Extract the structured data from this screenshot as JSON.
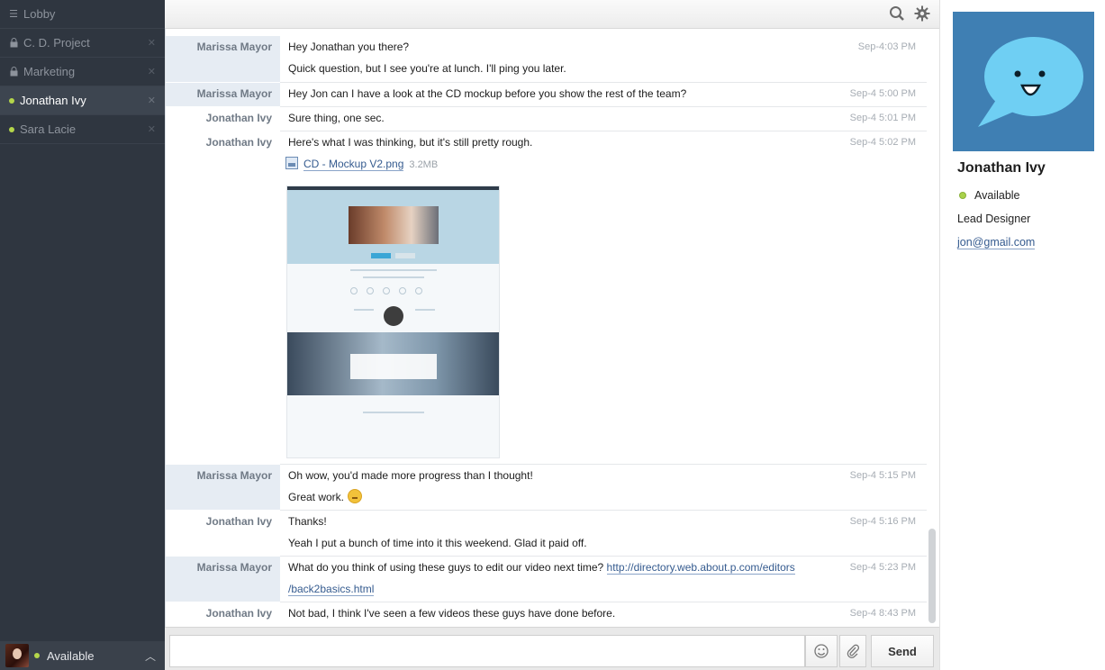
{
  "sidebar": {
    "items": [
      {
        "label": "Lobby",
        "icon": "list-icon"
      },
      {
        "label": "C. D. Project",
        "icon": "lock-icon"
      },
      {
        "label": "Marketing",
        "icon": "lock-icon"
      },
      {
        "label": "Jonathan Ivy",
        "icon": "online-dot-icon",
        "active": true
      },
      {
        "label": "Sara Lacie",
        "icon": "online-dot-icon"
      }
    ],
    "footer_status": "Available"
  },
  "toolbar": {
    "icons": [
      "search-icon",
      "gear-icon"
    ]
  },
  "messages": [
    {
      "sender": "Marissa Mayor",
      "lines": [
        "Hey Jonathan you there?",
        "Quick question, but I see you're at lunch. I'll ping you later."
      ],
      "time": "Sep-4:03 PM"
    },
    {
      "sender": "Marissa Mayor",
      "lines": [
        "Hey Jon can I have a look at the CD mockup before you show the rest of the team?"
      ],
      "time": "Sep-4 5:00 PM"
    },
    {
      "sender": "Jonathan Ivy",
      "lines": [
        "Sure thing, one sec."
      ],
      "time": "Sep-4 5:01 PM"
    },
    {
      "sender": "Jonathan Ivy",
      "lines": [
        "Here's what I was thinking, but it's still pretty rough."
      ],
      "time": "Sep-4 5:02 PM",
      "attachment": {
        "name": "CD - Mockup V2.png",
        "size": "3.2MB"
      }
    },
    {
      "sender": "Marissa Mayor",
      "lines": [
        "Oh wow, you'd made more progress than I thought!",
        "Great work."
      ],
      "time": "Sep-4 5:15 PM"
    },
    {
      "sender": "Jonathan Ivy",
      "lines": [
        "Thanks!",
        "Yeah I put a bunch of time into it this weekend. Glad it paid off."
      ],
      "time": "Sep-4 5:16 PM"
    },
    {
      "sender": "Marissa Mayor",
      "lines": [
        "What do you think of using these guys to edit our video next time?"
      ],
      "link": [
        "http://directory.web.about.p.com/editors",
        "/back2basics.html"
      ],
      "time": "Sep-4 5:23 PM"
    },
    {
      "sender": "Jonathan Ivy",
      "lines": [
        "Not bad, I think I've seen a few videos these guys have done before."
      ],
      "time": "Sep-4 8:43 PM"
    }
  ],
  "composer": {
    "placeholder": "",
    "send_label": "Send",
    "emoji_icon": "smiley-icon",
    "attach_icon": "paperclip-icon"
  },
  "profile": {
    "name": "Jonathan Ivy",
    "status": "Available",
    "role": "Lead Designer",
    "email": "jon@gmail.com"
  },
  "colors": {
    "sidebar_bg": "#2f3640",
    "online": "#b4d64a",
    "profile_pic_bg": "#3f7fb3",
    "speech_bubble": "#6fcff3",
    "link": "#355b8f"
  }
}
